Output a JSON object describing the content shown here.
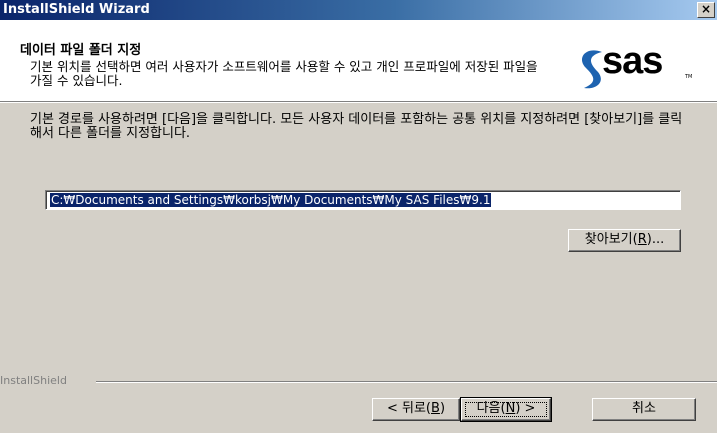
{
  "window": {
    "title": "InstallShield Wizard",
    "close_symbol": "×"
  },
  "header": {
    "title": "데이터 파일 폴더 지정",
    "description": "기본 위치를 선택하면 여러 사용자가 소프트웨어를 사용할 수 있고 개인 프로파일에 저장된 파일을 가질 수 있습니다.",
    "logo_text": "sas",
    "logo_trademark": "TM"
  },
  "body": {
    "instructions": "기본 경로를 사용하려면 [다음]을 클릭합니다. 모든 사용자 데이터를 포함하는 공통 위치를 지정하려면 [찾아보기]를 클릭해서 다른 폴더를 지정합니다.",
    "path_value": "C:₩Documents and Settings₩korbsj₩My Documents₩My SAS Files₩9.1",
    "browse_label_prefix": "찾아보기(",
    "browse_hotkey": "R",
    "browse_label_suffix": ")..."
  },
  "footer": {
    "brand": "InstallShield",
    "back_prefix": "< 뒤로(",
    "back_hotkey": "B",
    "back_suffix": ")",
    "next_prefix": "다음(",
    "next_hotkey": "N",
    "next_suffix": ") >",
    "cancel_label": "취소"
  },
  "colors": {
    "titlebar_start": "#0a246a",
    "titlebar_end": "#a6caf0",
    "selection": "#0a246a",
    "dialog_face": "#d4d0c8",
    "logo_swoosh": "#1e63b0"
  }
}
